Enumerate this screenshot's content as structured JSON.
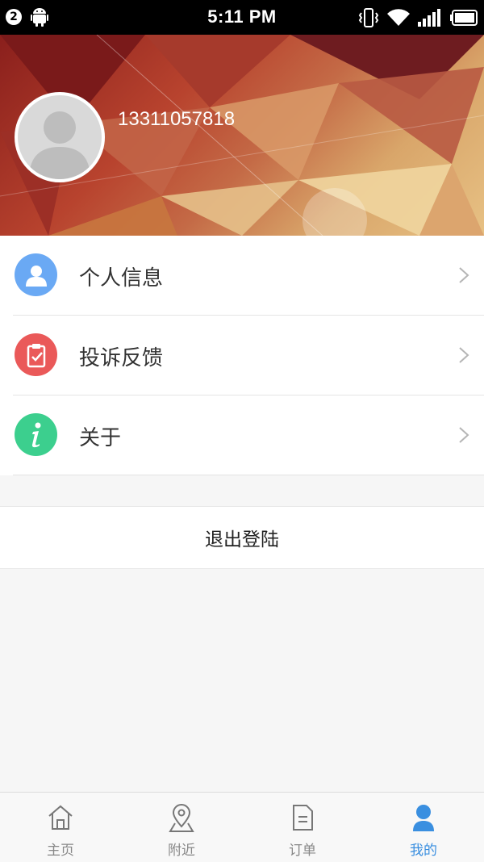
{
  "status_bar": {
    "notification_count": "2",
    "time": "5:11 PM",
    "icons": [
      "android-icon",
      "vibrate-icon",
      "wifi-icon",
      "signal-icon",
      "battery-icon"
    ]
  },
  "profile": {
    "phone": "13311057818"
  },
  "menu": {
    "items": [
      {
        "label": "个人信息",
        "icon": "user-icon",
        "color": "#6aa9f4"
      },
      {
        "label": "投诉反馈",
        "icon": "clipboard-check-icon",
        "color": "#ea5959"
      },
      {
        "label": "关于",
        "icon": "info-icon",
        "color": "#3ccf8e"
      }
    ]
  },
  "logout_label": "退出登陆",
  "tabbar": {
    "tabs": [
      {
        "label": "主页",
        "icon": "home-icon",
        "active": false
      },
      {
        "label": "附近",
        "icon": "map-pin-icon",
        "active": false
      },
      {
        "label": "订单",
        "icon": "document-icon",
        "active": false
      },
      {
        "label": "我的",
        "icon": "person-icon",
        "active": true
      }
    ],
    "active_color": "#3a8fe0",
    "inactive_color": "#888888"
  }
}
